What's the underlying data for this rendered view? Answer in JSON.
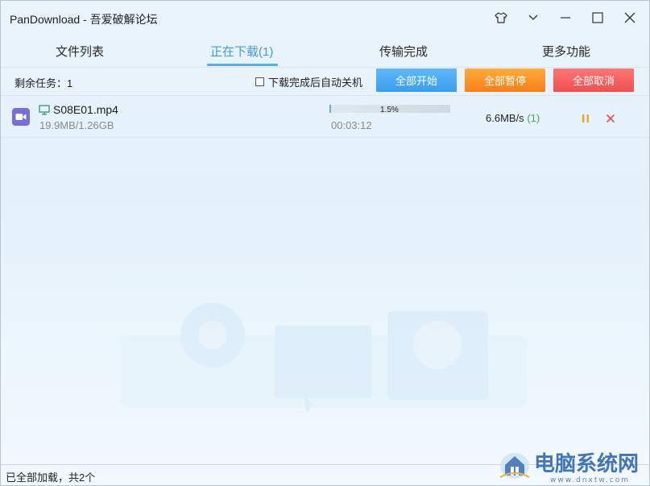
{
  "window": {
    "title": "PanDownload - 吾爱破解论坛"
  },
  "tabs": [
    {
      "label": "文件列表",
      "active": false
    },
    {
      "label": "正在下载(1)",
      "active": true
    },
    {
      "label": "传输完成",
      "active": false
    },
    {
      "label": "更多功能",
      "active": false
    }
  ],
  "toolbar": {
    "remaining_tasks": "剩余任务：1",
    "auto_shutdown_label": "下载完成后自动关机",
    "auto_shutdown_checked": false,
    "start_all_label": "全部开始",
    "pause_all_label": "全部暂停",
    "cancel_all_label": "全部取消"
  },
  "downloads": [
    {
      "file_name": "S08E01.mp4",
      "size": "19.9MB/1.26GB",
      "progress_fraction": 0.015,
      "progress_text": "1.5%",
      "elapsed": "00:03:12",
      "speed": "6.6MB/s",
      "connections": "(1)",
      "file_type_icon": "video-file-icon"
    }
  ],
  "status": {
    "text": "已全部加载，共2个"
  },
  "colors": {
    "accent_blue": "#3d9be0",
    "start_button": "#4aa9f3",
    "pause_button": "#fb8b22",
    "cancel_button": "#f25a5a",
    "connections_green": "#3cae4f",
    "pause_icon": "#f0a030",
    "cancel_icon": "#e84d4d"
  }
}
